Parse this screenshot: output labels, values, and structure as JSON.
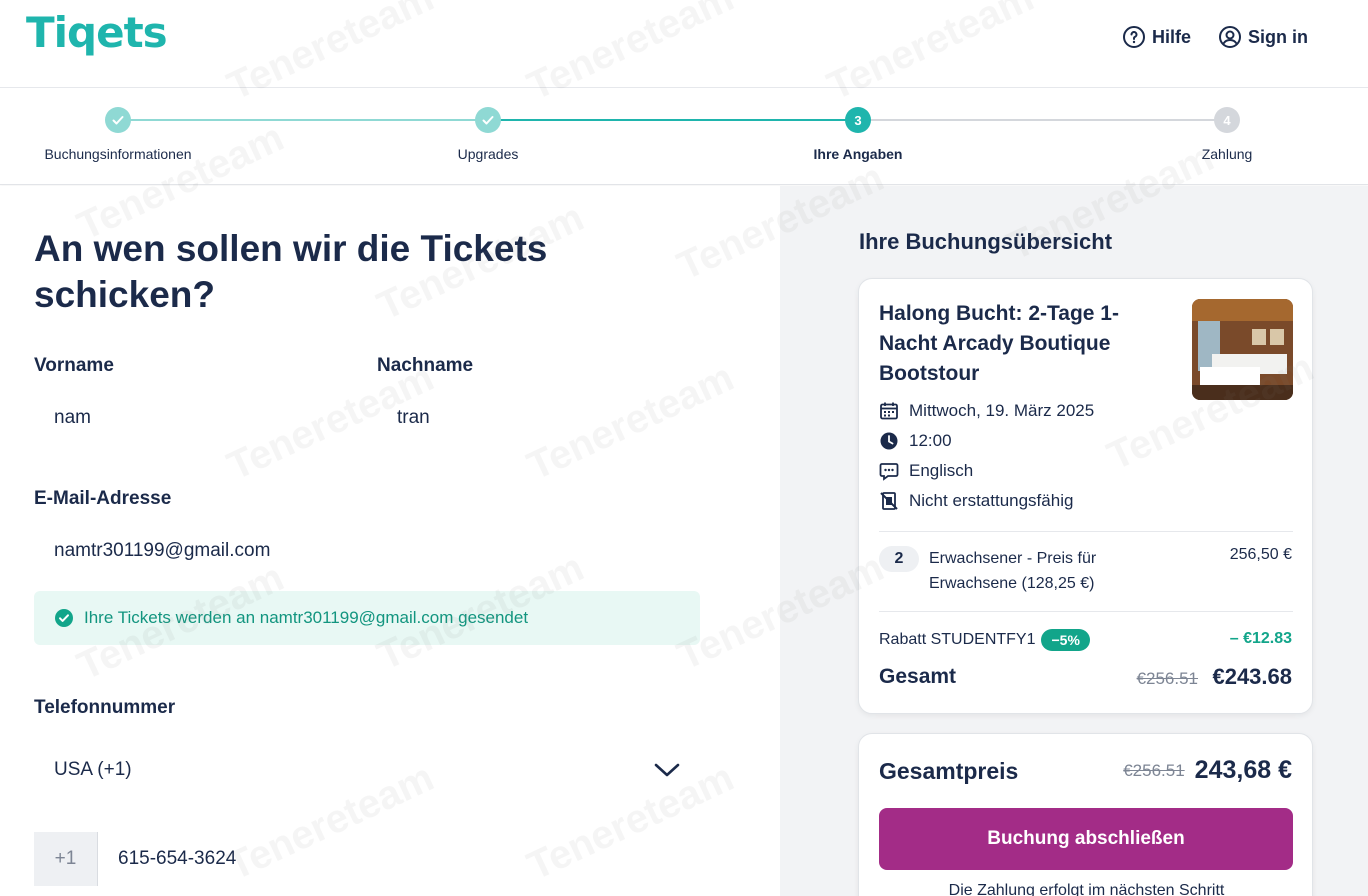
{
  "header": {
    "logo": "Tiqets",
    "help_label": "Hilfe",
    "signin_label": "Sign in"
  },
  "stepper": {
    "steps": [
      {
        "number": "1",
        "label": "Buchungsinformationen",
        "state": "done"
      },
      {
        "number": "2",
        "label": "Upgrades",
        "state": "done"
      },
      {
        "number": "3",
        "label": "Ihre Angaben",
        "state": "active"
      },
      {
        "number": "4",
        "label": "Zahlung",
        "state": "pending"
      }
    ]
  },
  "form": {
    "title": "An wen sollen wir die Tickets schicken?",
    "firstname_label": "Vorname",
    "firstname_value": "nam",
    "lastname_label": "Nachname",
    "lastname_value": "tran",
    "email_label": "E-Mail-Adresse",
    "email_value": "namtr301199@gmail.com",
    "email_notice": "Ihre Tickets werden an namtr301199@gmail.com gesendet",
    "phone_label": "Telefonnummer",
    "country_value": "USA (+1)",
    "phone_prefix": "+1",
    "phone_value": "615-654-3624"
  },
  "summary": {
    "title": "Ihre Buchungsübersicht",
    "tour_title": "Halong Bucht: 2-Tage 1-Nacht Arcady Boutique Bootstour",
    "date": "Mittwoch, 19. März 2025",
    "time": "12:00",
    "language": "Englisch",
    "refund": "Nicht erstattungsfähig",
    "ticket_qty": "2",
    "ticket_desc": "Erwachsener - Preis für Erwachsene (128,25 €)",
    "ticket_price": "256,50 €",
    "discount_label": "Rabatt STUDENTFY1",
    "discount_badge": "−5%",
    "discount_value": "– €12.83",
    "total_label": "Gesamt",
    "total_old": "€256.51",
    "total_new": "€243.68"
  },
  "checkout": {
    "label": "Gesamtpreis",
    "old_price": "€256.51",
    "new_price": "243,68 €",
    "button_label": "Buchung abschließen",
    "note": "Die Zahlung erfolgt im nächsten Schritt"
  },
  "colors": {
    "brand": "#1fb5ad",
    "accent": "#a32c87",
    "success": "#12a58a",
    "text": "#1b2a4a"
  },
  "watermark": "Tenereteam"
}
